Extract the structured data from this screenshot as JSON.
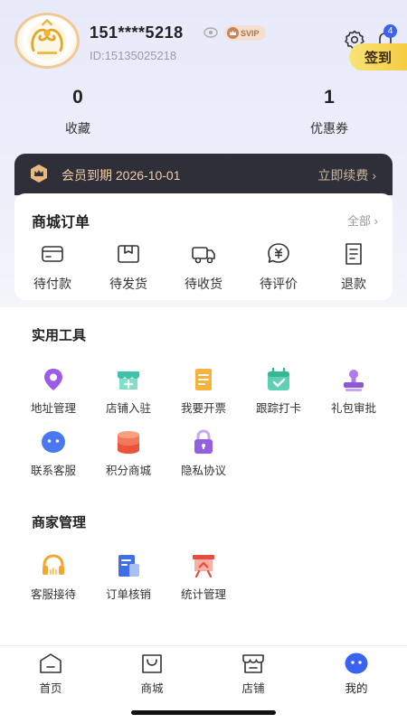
{
  "profile": {
    "phone": "151****5218",
    "uid": "ID:15135025218",
    "svip_label": "SVIP",
    "signin_label": "签到",
    "notification_count": "4"
  },
  "stats": {
    "favorites": {
      "value": "0",
      "label": "收藏"
    },
    "coupons": {
      "value": "1",
      "label": "优惠券"
    }
  },
  "vip": {
    "expire_text": "会员到期 2026-10-01",
    "renew_label": "立即续费 ›"
  },
  "orders": {
    "title": "商城订单",
    "all_label": "全部 ›",
    "items": [
      {
        "label": "待付款",
        "icon": "card-icon"
      },
      {
        "label": "待发货",
        "icon": "box-icon"
      },
      {
        "label": "待收货",
        "icon": "truck-icon"
      },
      {
        "label": "待评价",
        "icon": "review-icon"
      },
      {
        "label": "退款",
        "icon": "refund-icon"
      }
    ]
  },
  "tools": {
    "title": "实用工具",
    "items": [
      {
        "label": "地址管理",
        "icon": "location-pin-icon"
      },
      {
        "label": "店铺入驻",
        "icon": "store-add-icon"
      },
      {
        "label": "我要开票",
        "icon": "invoice-icon"
      },
      {
        "label": "跟踪打卡",
        "icon": "calendar-check-icon"
      },
      {
        "label": "礼包审批",
        "icon": "stamp-icon"
      },
      {
        "label": "联系客服",
        "icon": "chat-bubble-icon"
      },
      {
        "label": "积分商城",
        "icon": "coins-icon"
      },
      {
        "label": "隐私协议",
        "icon": "lock-icon"
      }
    ]
  },
  "merchant": {
    "title": "商家管理",
    "items": [
      {
        "label": "客服接待",
        "icon": "headset-icon"
      },
      {
        "label": "订单核销",
        "icon": "document-icon"
      },
      {
        "label": "统计管理",
        "icon": "chart-board-icon"
      }
    ]
  },
  "tabbar": {
    "items": [
      {
        "label": "首页",
        "icon": "home-icon"
      },
      {
        "label": "商城",
        "icon": "shopping-bag-icon"
      },
      {
        "label": "店铺",
        "icon": "shop-icon"
      },
      {
        "label": "我的",
        "icon": "profile-face-icon",
        "active": true
      }
    ]
  },
  "colors": {
    "accent_blue": "#3a63f2",
    "signin_yellow": "#f5c93b",
    "vip_bar": "#2e2f38",
    "vip_gold": "#f0cfa9"
  }
}
